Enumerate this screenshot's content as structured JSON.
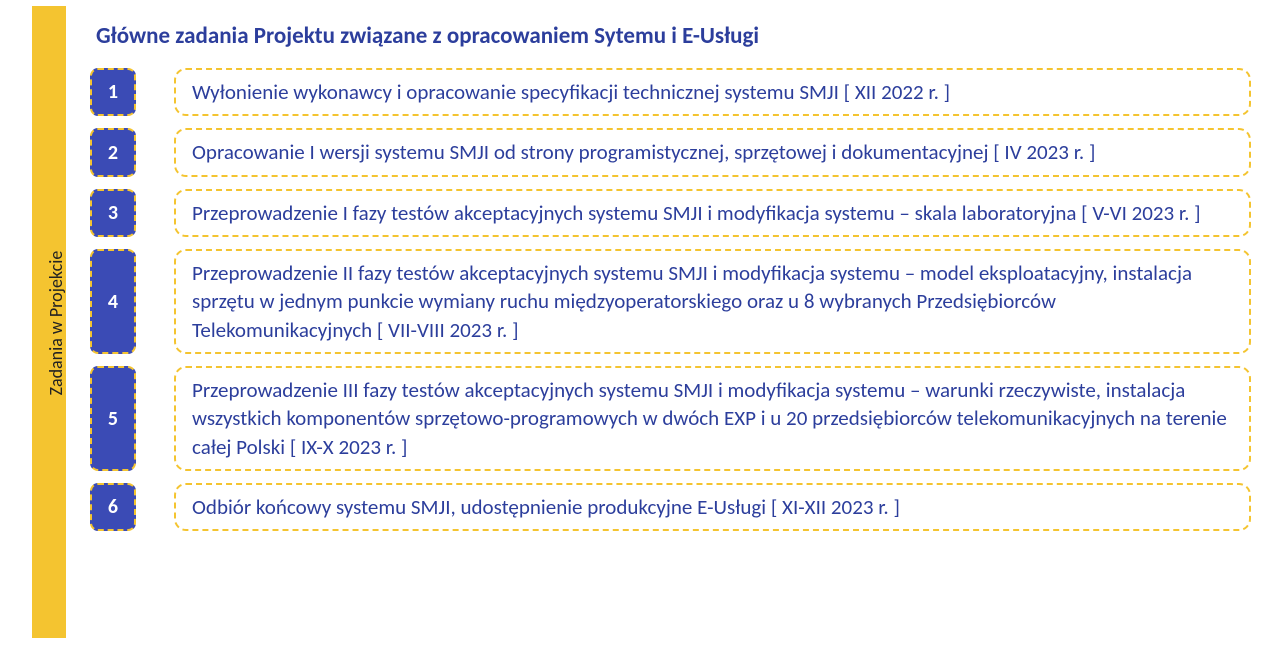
{
  "side_label": "Zadania w Projekcie",
  "title": "Główne zadania Projektu związane z opracowaniem Sytemu i E-Usługi",
  "tasks": [
    {
      "num": "1",
      "text": "Wyłonienie wykonawcy i opracowanie specyfikacji technicznej systemu SMJI [ XII 2022 r. ]"
    },
    {
      "num": "2",
      "text": "Opracowanie I wersji systemu SMJI od strony programistycznej, sprzętowej i dokumentacyjnej [ IV 2023 r. ]"
    },
    {
      "num": "3",
      "text": "Przeprowadzenie I fazy testów akceptacyjnych systemu SMJI i modyfikacja systemu – skala laboratoryjna [ V-VI 2023 r. ]"
    },
    {
      "num": "4",
      "text": "Przeprowadzenie II fazy testów akceptacyjnych systemu SMJI i modyfikacja systemu – model eksploatacyjny, instalacja sprzętu w jednym punkcie wymiany ruchu międzyoperatorskiego oraz u 8 wybranych Przedsiębiorców Telekomunikacyjnych [ VII-VIII 2023 r. ]"
    },
    {
      "num": "5",
      "text": "Przeprowadzenie III fazy testów akceptacyjnych systemu SMJI i modyfikacja systemu – warunki rzeczywiste, instalacja wszystkich komponentów sprzętowo-programowych w dwóch EXP i u 20 przedsiębiorców telekomunikacyjnych na terenie całej Polski [ IX-X 2023 r. ]"
    },
    {
      "num": "6",
      "text": "Odbiór końcowy systemu SMJI, udostępnienie produkcyjne E-Usługi [ XI-XII 2023 r. ]"
    }
  ]
}
